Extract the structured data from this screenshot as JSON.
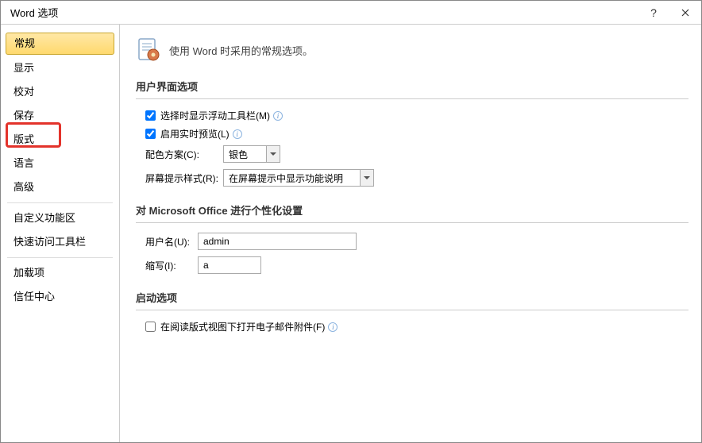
{
  "window": {
    "title": "Word 选项"
  },
  "sidebar": {
    "items": [
      {
        "label": "常规"
      },
      {
        "label": "显示"
      },
      {
        "label": "校对"
      },
      {
        "label": "保存"
      },
      {
        "label": "版式"
      },
      {
        "label": "语言"
      },
      {
        "label": "高级"
      },
      {
        "label": "自定义功能区"
      },
      {
        "label": "快速访问工具栏"
      },
      {
        "label": "加载项"
      },
      {
        "label": "信任中心"
      }
    ]
  },
  "header": {
    "text": "使用 Word 时采用的常规选项。"
  },
  "sections": {
    "ui": {
      "title": "用户界面选项",
      "showMiniToolbar": "选择时显示浮动工具栏(M)",
      "enableLivePreview": "启用实时预览(L)",
      "colorSchemeLabel": "配色方案(C):",
      "colorSchemeValue": "银色",
      "screenTipLabel": "屏幕提示样式(R):",
      "screenTipValue": "在屏幕提示中显示功能说明"
    },
    "personalize": {
      "title": "对 Microsoft Office 进行个性化设置",
      "usernameLabel": "用户名(U):",
      "usernameValue": "admin",
      "initialsLabel": "缩写(I):",
      "initialsValue": "a"
    },
    "startup": {
      "title": "启动选项",
      "openAttachments": "在阅读版式视图下打开电子邮件附件(F)"
    }
  }
}
